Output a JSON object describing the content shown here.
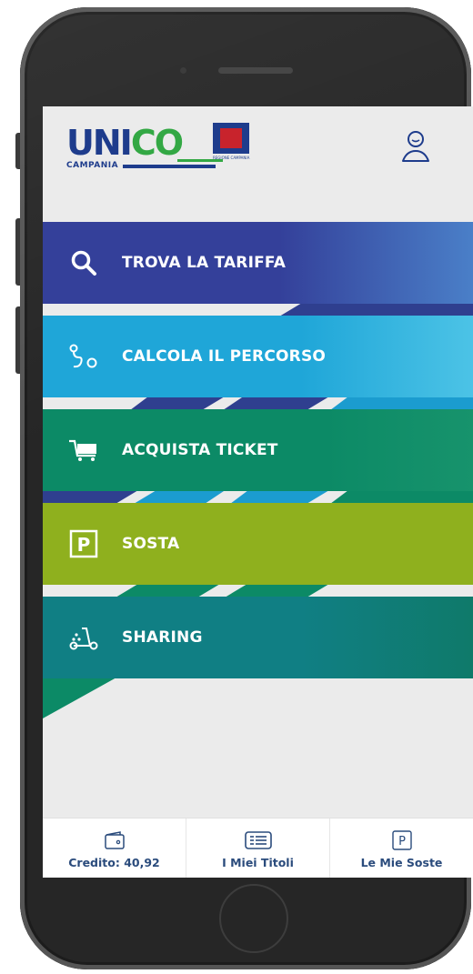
{
  "app": {
    "logo_main_dark": "UNI",
    "logo_main_green": "CO",
    "logo_sub": "CAMPANIA",
    "region_caption": "REGIONE CAMPANIA"
  },
  "menu": [
    {
      "label": "TROVA LA TARIFFA",
      "icon": "search-icon",
      "color": "#34409a"
    },
    {
      "label": "CALCOLA IL PERCORSO",
      "icon": "route-icon",
      "color": "#1fa6d8"
    },
    {
      "label": "ACQUISTA TICKET",
      "icon": "cart-icon",
      "color": "#0c8a66"
    },
    {
      "label": "SOSTA",
      "icon": "parking-icon",
      "color": "#8fb01e"
    },
    {
      "label": "SHARING",
      "icon": "scooter-icon",
      "color": "#107f84"
    }
  ],
  "bottombar": {
    "credit": "Credito: 40,92",
    "titles": "I Miei Titoli",
    "parking": "Le Mie Soste"
  },
  "colors": {
    "brand_blue": "#1e3c8c",
    "brand_green": "#33a844",
    "tab_text": "#2a4b7c",
    "screen_bg": "#ebebeb"
  }
}
